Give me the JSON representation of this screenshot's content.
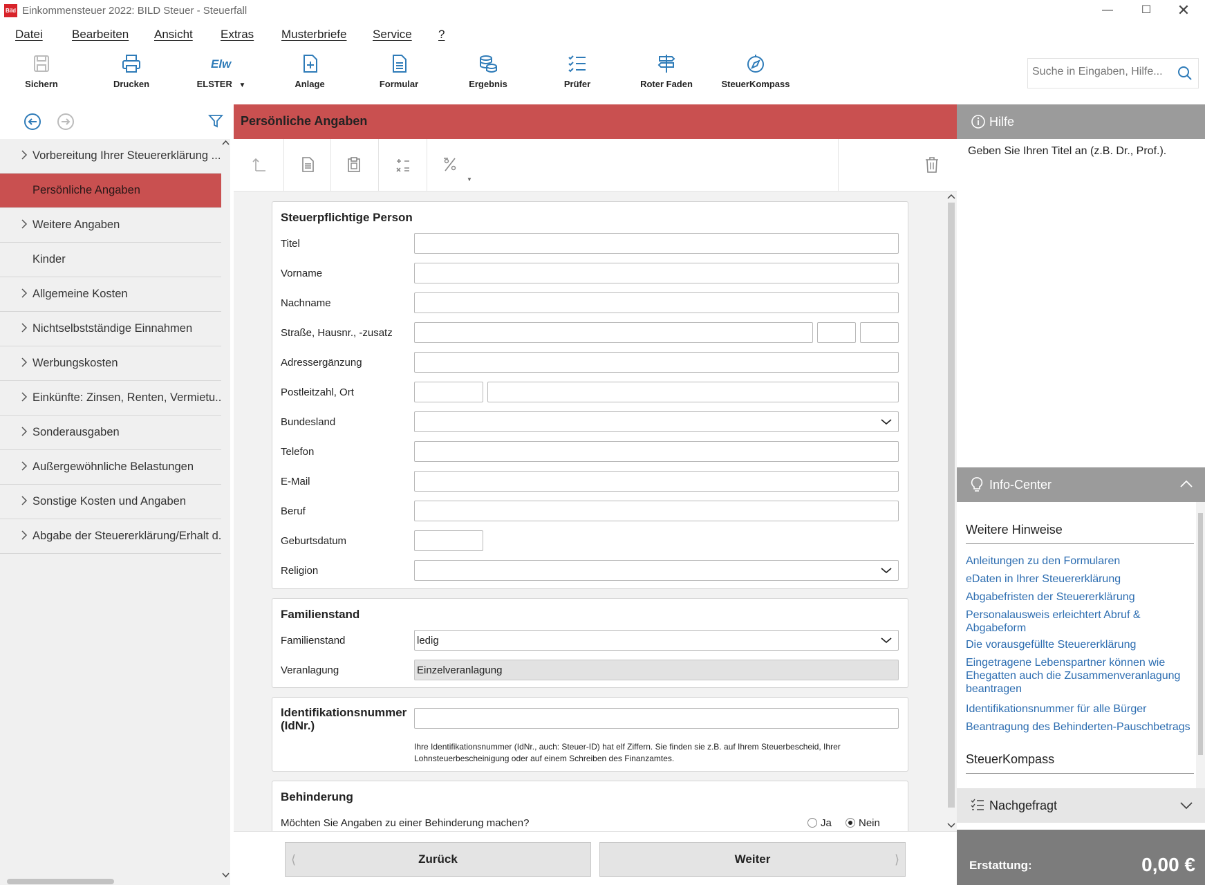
{
  "window": {
    "title": "Einkommensteuer 2022: BILD Steuer - Steuerfall",
    "logo_text": "Bild"
  },
  "menu": [
    "Datei",
    "Bearbeiten",
    "Ansicht",
    "Extras",
    "Musterbriefe",
    "Service",
    "?"
  ],
  "toolbar": {
    "sichern": "Sichern",
    "drucken": "Drucken",
    "elster": "ELSTER",
    "anlage": "Anlage",
    "formular": "Formular",
    "ergebnis": "Ergebnis",
    "pruefer": "Prüfer",
    "roter_faden": "Roter Faden",
    "steuerkompass": "SteuerKompass"
  },
  "search": {
    "placeholder": "Suche in Eingaben, Hilfe..."
  },
  "sidebar": {
    "items": [
      {
        "label": "Vorbereitung Ihrer Steuererklärung ...",
        "chevron": true
      },
      {
        "label": "Persönliche Angaben",
        "chevron": false,
        "active": true
      },
      {
        "label": "Weitere Angaben",
        "chevron": true
      },
      {
        "label": "Kinder",
        "chevron": false
      },
      {
        "label": "Allgemeine Kosten",
        "chevron": true
      },
      {
        "label": "Nichtselbstständige Einnahmen",
        "chevron": true
      },
      {
        "label": "Werbungskosten",
        "chevron": true
      },
      {
        "label": "Einkünfte: Zinsen, Renten, Vermietu...",
        "chevron": true
      },
      {
        "label": "Sonderausgaben",
        "chevron": true
      },
      {
        "label": "Außergewöhnliche Belastungen",
        "chevron": true
      },
      {
        "label": "Sonstige Kosten und Angaben",
        "chevron": true
      },
      {
        "label": "Abgabe der Steuererklärung/Erhalt d...",
        "chevron": true
      }
    ]
  },
  "main": {
    "title": "Persönliche Angaben",
    "sections": {
      "person": {
        "title": "Steuerpflichtige Person",
        "fields": {
          "titel": "Titel",
          "vorname": "Vorname",
          "nachname": "Nachname",
          "strasse": "Straße, Hausnr., -zusatz",
          "adresszusatz": "Adressergänzung",
          "plz": "Postleitzahl, Ort",
          "bundesland": "Bundesland",
          "telefon": "Telefon",
          "email": "E-Mail",
          "beruf": "Beruf",
          "geburtsdatum": "Geburtsdatum",
          "religion": "Religion"
        }
      },
      "familienstand": {
        "title": "Familienstand",
        "label_familienstand": "Familienstand",
        "value_familienstand": "ledig",
        "label_veranlagung": "Veranlagung",
        "value_veranlagung": "Einzelveranlagung"
      },
      "idnr": {
        "title_line1": "Identifikationsnummer",
        "title_line2": "(IdNr.)",
        "hint_line1": "Ihre Identifikationsnummer (IdNr., auch: Steuer-ID) hat elf Ziffern. Sie finden sie z.B. auf Ihrem Steuerbescheid, Ihrer",
        "hint_line2": "Lohnsteuerbescheinigung oder auf einem Schreiben des Finanzamtes."
      },
      "behinderung": {
        "title": "Behinderung",
        "question": "Möchten Sie Angaben zu einer Behinderung machen?",
        "ja": "Ja",
        "nein": "Nein",
        "selected": "Nein"
      }
    },
    "buttons": {
      "back": "Zurück",
      "next": "Weiter"
    }
  },
  "help": {
    "title": "Hilfe",
    "text": "Geben Sie Ihren Titel an (z.B. Dr., Prof.)."
  },
  "info_center": {
    "title": "Info-Center",
    "weitere_hinweise": "Weitere Hinweise",
    "links": [
      [
        "Anleitungen zu den Formularen"
      ],
      [
        "eDaten in Ihrer Steuererklärung"
      ],
      [
        "Abgabefristen der Steuererklärung"
      ],
      [
        "Personalausweis erleichtert Abruf &",
        "Abgabeform"
      ],
      [
        "Die vorausgefüllte Steuererklärung"
      ],
      [
        "Eingetragene Lebenspartner können wie",
        "Ehegatten auch die Zusammenveranlagung",
        "beantragen"
      ],
      [
        "Identifikationsnummer für alle Bürger"
      ],
      [
        "Beantragung des Behinderten-Pauschbetrags"
      ]
    ],
    "steuerkompass": "SteuerKompass"
  },
  "nachgefragt": {
    "title": "Nachgefragt"
  },
  "erstattung": {
    "label": "Erstattung:",
    "value": "0,00 €"
  },
  "colors": {
    "accent": "#c95050",
    "panel_grey": "#9b9b9b",
    "link": "#2b6cb0",
    "footer_grey": "#7c7c7c"
  }
}
